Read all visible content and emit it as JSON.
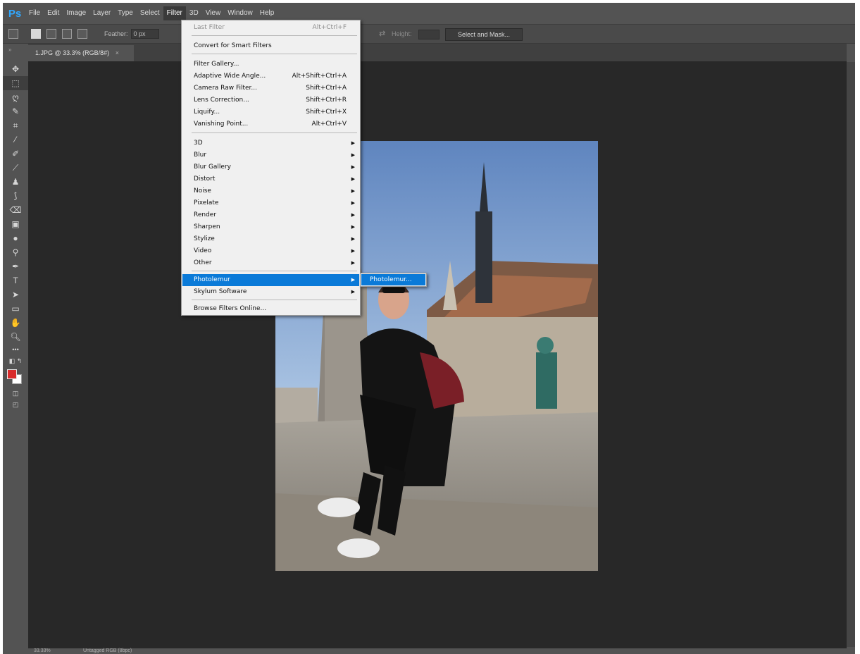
{
  "app": {
    "logo": "Ps"
  },
  "menu": [
    "File",
    "Edit",
    "Image",
    "Layer",
    "Type",
    "Select",
    "Filter",
    "3D",
    "View",
    "Window",
    "Help"
  ],
  "options": {
    "feather_label": "Feather:",
    "feather_value": "0 px",
    "height_label": "Height:",
    "select_and_mask": "Select and Mask..."
  },
  "document": {
    "tab_title": "1.JPG @ 33.3% (RGB/8#)",
    "close": "×"
  },
  "status": {
    "zoom": "33.33%",
    "doc": "Untagged RGB (8bpc)"
  },
  "filter_menu": {
    "last_filter": {
      "label": "Last Filter",
      "shortcut": "Alt+Ctrl+F"
    },
    "convert": "Convert for Smart Filters",
    "items": [
      {
        "label": "Filter Gallery...",
        "shortcut": ""
      },
      {
        "label": "Adaptive Wide Angle...",
        "shortcut": "Alt+Shift+Ctrl+A"
      },
      {
        "label": "Camera Raw Filter...",
        "shortcut": "Shift+Ctrl+A"
      },
      {
        "label": "Lens Correction...",
        "shortcut": "Shift+Ctrl+R"
      },
      {
        "label": "Liquify...",
        "shortcut": "Shift+Ctrl+X"
      },
      {
        "label": "Vanishing Point...",
        "shortcut": "Alt+Ctrl+V"
      }
    ],
    "submenus": [
      "3D",
      "Blur",
      "Blur Gallery",
      "Distort",
      "Noise",
      "Pixelate",
      "Render",
      "Sharpen",
      "Stylize",
      "Video",
      "Other"
    ],
    "plugins": [
      "Photolemur",
      "Skylum Software"
    ],
    "browse": "Browse Filters Online..."
  },
  "photolemur_submenu": {
    "label": "Photolemur..."
  },
  "tools": [
    "move-tool-icon",
    "marquee-tool-icon",
    "lasso-tool-icon",
    "quick-select-tool-icon",
    "crop-tool-icon",
    "eyedropper-tool-icon",
    "healing-brush-tool-icon",
    "brush-tool-icon",
    "clone-stamp-tool-icon",
    "history-brush-tool-icon",
    "eraser-tool-icon",
    "gradient-tool-icon",
    "blur-tool-icon",
    "dodge-tool-icon",
    "pen-tool-icon",
    "type-tool-icon",
    "path-select-tool-icon",
    "rectangle-tool-icon",
    "hand-tool-icon",
    "zoom-tool-icon"
  ],
  "colors": {
    "accent": "#0a7ad8",
    "foreground": "#d92b2b",
    "background": "#ffffff"
  }
}
